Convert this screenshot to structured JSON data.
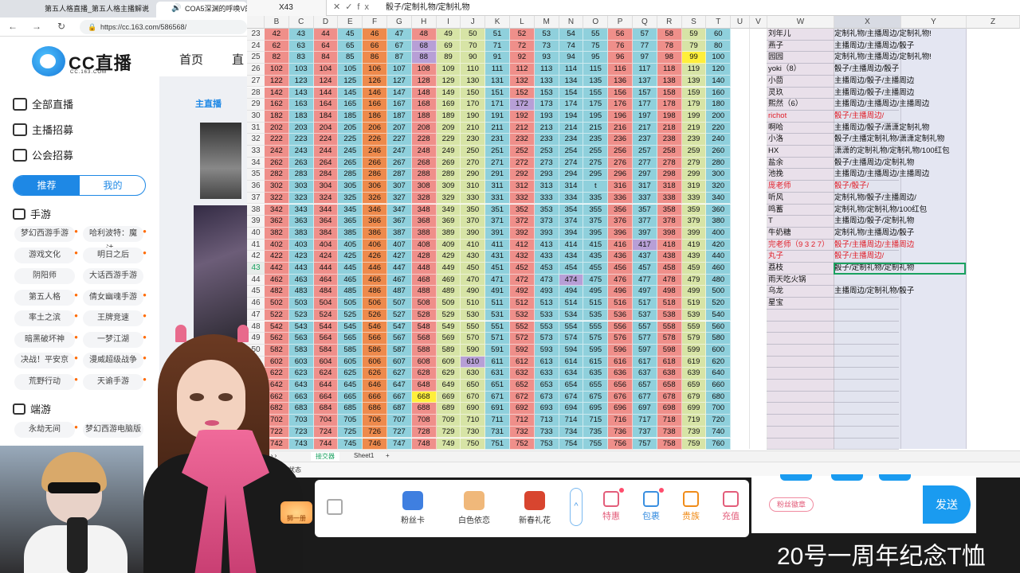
{
  "browser": {
    "tabs": [
      {
        "label": "第五人格直播_第五人格主播解说",
        "active": false
      },
      {
        "label": "COA5深渊的呼唤V的",
        "active": true
      }
    ],
    "url": "https://cc.163.com/586568/"
  },
  "site": {
    "logo_text": "CC直播",
    "logo_sub": "CC.163.COM",
    "top_nav": [
      "首页",
      "直"
    ],
    "sidebar": [
      {
        "label": "全部直播"
      },
      {
        "label": "主播招募"
      },
      {
        "label": "公会招募"
      }
    ],
    "segment": {
      "on": "推荐",
      "off": "我的"
    },
    "mobile_title": "手游",
    "mobile_games": [
      "梦幻西游手游",
      "哈利波特：魔法...",
      "游戏文化",
      "明日之后",
      "阴阳师",
      "大话西游手游",
      "第五人格",
      "倩女幽魂手游",
      "率土之滨",
      "王牌竞速",
      "暗黑破坏神",
      "一梦江湖",
      "决战！平安京",
      "漫威超级战争",
      "荒野行动",
      "天谕手游"
    ],
    "pc_title": "端游",
    "pc_games": [
      "永劫无间",
      "梦幻西游电脑版"
    ],
    "recommend_label": "主直播"
  },
  "sheet": {
    "cell_ref": "X43",
    "formula": "骰子/定制礼物/定制礼物",
    "columns": [
      "B",
      "C",
      "D",
      "E",
      "F",
      "G",
      "H",
      "I",
      "J",
      "K",
      "L",
      "M",
      "N",
      "O",
      "P",
      "Q",
      "R",
      "S",
      "T",
      "U",
      "V",
      "W",
      "X",
      "Y",
      "Z"
    ],
    "first_row": 23,
    "rows": [
      {
        "r": 23,
        "cells": [
          "42",
          "43",
          "44",
          "45",
          "46",
          "47",
          "48",
          "49",
          "50",
          "51",
          "52",
          "53",
          "54",
          "55",
          "56",
          "57",
          "58",
          "59",
          "60"
        ]
      },
      {
        "r": 24,
        "cells": [
          "62",
          "63",
          "64",
          "65",
          "66",
          "67",
          "68",
          "69",
          "70",
          "71",
          "72",
          "73",
          "74",
          "75",
          "76",
          "77",
          "78",
          "79",
          "80"
        ]
      },
      {
        "r": 25,
        "cells": [
          "82",
          "83",
          "84",
          "85",
          "86",
          "87",
          "88",
          "89",
          "90",
          "91",
          "92",
          "93",
          "94",
          "95",
          "96",
          "97",
          "98",
          "99",
          "100"
        ]
      },
      {
        "r": 26,
        "cells": [
          "102",
          "103",
          "104",
          "105",
          "106",
          "107",
          "108",
          "109",
          "110",
          "111",
          "112",
          "113",
          "114",
          "115",
          "116",
          "117",
          "118",
          "119",
          "120"
        ]
      },
      {
        "r": 27,
        "cells": [
          "122",
          "123",
          "124",
          "125",
          "126",
          "127",
          "128",
          "129",
          "130",
          "131",
          "132",
          "133",
          "134",
          "135",
          "136",
          "137",
          "138",
          "139",
          "140"
        ]
      },
      {
        "r": 28,
        "cells": [
          "142",
          "143",
          "144",
          "145",
          "146",
          "147",
          "148",
          "149",
          "150",
          "151",
          "152",
          "153",
          "154",
          "155",
          "156",
          "157",
          "158",
          "159",
          "160"
        ]
      },
      {
        "r": 29,
        "cells": [
          "162",
          "163",
          "164",
          "165",
          "166",
          "167",
          "168",
          "169",
          "170",
          "171",
          "172",
          "173",
          "174",
          "175",
          "176",
          "177",
          "178",
          "179",
          "180"
        ]
      },
      {
        "r": 30,
        "cells": [
          "182",
          "183",
          "184",
          "185",
          "186",
          "187",
          "188",
          "189",
          "190",
          "191",
          "192",
          "193",
          "194",
          "195",
          "196",
          "197",
          "198",
          "199",
          "200"
        ]
      },
      {
        "r": 31,
        "cells": [
          "202",
          "203",
          "204",
          "205",
          "206",
          "207",
          "208",
          "209",
          "210",
          "211",
          "212",
          "213",
          "214",
          "215",
          "216",
          "217",
          "218",
          "219",
          "220"
        ]
      },
      {
        "r": 32,
        "cells": [
          "222",
          "223",
          "224",
          "225",
          "226",
          "227",
          "228",
          "229",
          "230",
          "231",
          "232",
          "233",
          "234",
          "235",
          "236",
          "237",
          "238",
          "239",
          "240"
        ]
      },
      {
        "r": 33,
        "cells": [
          "242",
          "243",
          "244",
          "245",
          "246",
          "247",
          "248",
          "249",
          "250",
          "251",
          "252",
          "253",
          "254",
          "255",
          "256",
          "257",
          "258",
          "259",
          "260"
        ]
      },
      {
        "r": 34,
        "cells": [
          "262",
          "263",
          "264",
          "265",
          "266",
          "267",
          "268",
          "269",
          "270",
          "271",
          "272",
          "273",
          "274",
          "275",
          "276",
          "277",
          "278",
          "279",
          "280"
        ]
      },
      {
        "r": 35,
        "cells": [
          "282",
          "283",
          "284",
          "285",
          "286",
          "287",
          "288",
          "289",
          "290",
          "291",
          "292",
          "293",
          "294",
          "295",
          "296",
          "297",
          "298",
          "299",
          "300"
        ]
      },
      {
        "r": 36,
        "cells": [
          "302",
          "303",
          "304",
          "305",
          "306",
          "307",
          "308",
          "309",
          "310",
          "311",
          "312",
          "313",
          "314",
          "t",
          "316",
          "317",
          "318",
          "319",
          "320"
        ]
      },
      {
        "r": 37,
        "cells": [
          "322",
          "323",
          "324",
          "325",
          "326",
          "327",
          "328",
          "329",
          "330",
          "331",
          "332",
          "333",
          "334",
          "335",
          "336",
          "337",
          "338",
          "339",
          "340"
        ]
      },
      {
        "r": 38,
        "cells": [
          "342",
          "343",
          "344",
          "345",
          "346",
          "347",
          "348",
          "349",
          "350",
          "351",
          "352",
          "353",
          "354",
          "355",
          "356",
          "357",
          "358",
          "359",
          "360"
        ]
      },
      {
        "r": 39,
        "cells": [
          "362",
          "363",
          "364",
          "365",
          "366",
          "367",
          "368",
          "369",
          "370",
          "371",
          "372",
          "373",
          "374",
          "375",
          "376",
          "377",
          "378",
          "379",
          "380"
        ]
      },
      {
        "r": 40,
        "cells": [
          "382",
          "383",
          "384",
          "385",
          "386",
          "387",
          "388",
          "389",
          "390",
          "391",
          "392",
          "393",
          "394",
          "395",
          "396",
          "397",
          "398",
          "399",
          "400"
        ]
      },
      {
        "r": 41,
        "cells": [
          "402",
          "403",
          "404",
          "405",
          "406",
          "407",
          "408",
          "409",
          "410",
          "411",
          "412",
          "413",
          "414",
          "415",
          "416",
          "417",
          "418",
          "419",
          "420"
        ]
      },
      {
        "r": 42,
        "cells": [
          "422",
          "423",
          "424",
          "425",
          "426",
          "427",
          "428",
          "429",
          "430",
          "431",
          "432",
          "433",
          "434",
          "435",
          "436",
          "437",
          "438",
          "439",
          "440"
        ]
      },
      {
        "r": 43,
        "cells": [
          "442",
          "443",
          "444",
          "445",
          "446",
          "447",
          "448",
          "449",
          "450",
          "451",
          "452",
          "453",
          "454",
          "455",
          "456",
          "457",
          "458",
          "459",
          "460"
        ]
      },
      {
        "r": 44,
        "cells": [
          "462",
          "463",
          "464",
          "465",
          "466",
          "467",
          "468",
          "469",
          "470",
          "471",
          "472",
          "473",
          "474",
          "475",
          "476",
          "477",
          "478",
          "479",
          "480"
        ]
      },
      {
        "r": 45,
        "cells": [
          "482",
          "483",
          "484",
          "485",
          "486",
          "487",
          "488",
          "489",
          "490",
          "491",
          "492",
          "493",
          "494",
          "495",
          "496",
          "497",
          "498",
          "499",
          "500"
        ]
      },
      {
        "r": 46,
        "cells": [
          "502",
          "503",
          "504",
          "505",
          "506",
          "507",
          "508",
          "509",
          "510",
          "511",
          "512",
          "513",
          "514",
          "515",
          "516",
          "517",
          "518",
          "519",
          "520"
        ]
      },
      {
        "r": 47,
        "cells": [
          "522",
          "523",
          "524",
          "525",
          "526",
          "527",
          "528",
          "529",
          "530",
          "531",
          "532",
          "533",
          "534",
          "535",
          "536",
          "537",
          "538",
          "539",
          "540"
        ]
      },
      {
        "r": 48,
        "cells": [
          "542",
          "543",
          "544",
          "545",
          "546",
          "547",
          "548",
          "549",
          "550",
          "551",
          "552",
          "553",
          "554",
          "555",
          "556",
          "557",
          "558",
          "559",
          "560"
        ]
      },
      {
        "r": 49,
        "cells": [
          "562",
          "563",
          "564",
          "565",
          "566",
          "567",
          "568",
          "569",
          "570",
          "571",
          "572",
          "573",
          "574",
          "575",
          "576",
          "577",
          "578",
          "579",
          "580"
        ]
      },
      {
        "r": 50,
        "cells": [
          "582",
          "583",
          "584",
          "585",
          "586",
          "587",
          "588",
          "589",
          "590",
          "591",
          "592",
          "593",
          "594",
          "595",
          "596",
          "597",
          "598",
          "599",
          "600"
        ]
      },
      {
        "r": 51,
        "cells": [
          "602",
          "603",
          "604",
          "605",
          "606",
          "607",
          "608",
          "609",
          "610",
          "611",
          "612",
          "613",
          "614",
          "615",
          "616",
          "617",
          "618",
          "619",
          "620"
        ]
      },
      {
        "r": 52,
        "cells": [
          "622",
          "623",
          "624",
          "625",
          "626",
          "627",
          "628",
          "629",
          "630",
          "631",
          "632",
          "633",
          "634",
          "635",
          "636",
          "637",
          "638",
          "639",
          "640"
        ]
      },
      {
        "r": 53,
        "cells": [
          "642",
          "643",
          "644",
          "645",
          "646",
          "647",
          "648",
          "649",
          "650",
          "651",
          "652",
          "653",
          "654",
          "655",
          "656",
          "657",
          "658",
          "659",
          "660"
        ]
      },
      {
        "r": 54,
        "cells": [
          "662",
          "663",
          "664",
          "665",
          "666",
          "667",
          "668",
          "669",
          "670",
          "671",
          "672",
          "673",
          "674",
          "675",
          "676",
          "677",
          "678",
          "679",
          "680"
        ]
      },
      {
        "r": 55,
        "cells": [
          "682",
          "683",
          "684",
          "685",
          "686",
          "687",
          "688",
          "689",
          "690",
          "691",
          "692",
          "693",
          "694",
          "695",
          "696",
          "697",
          "698",
          "699",
          "700"
        ]
      },
      {
        "r": 56,
        "cells": [
          "702",
          "703",
          "704",
          "705",
          "706",
          "707",
          "708",
          "709",
          "710",
          "711",
          "712",
          "713",
          "714",
          "715",
          "716",
          "717",
          "718",
          "719",
          "720"
        ]
      },
      {
        "r": 57,
        "cells": [
          "722",
          "723",
          "724",
          "725",
          "726",
          "727",
          "728",
          "729",
          "730",
          "731",
          "732",
          "733",
          "734",
          "735",
          "736",
          "737",
          "738",
          "739",
          "740"
        ]
      },
      {
        "r": 58,
        "cells": [
          "742",
          "743",
          "744",
          "745",
          "746",
          "747",
          "748",
          "749",
          "750",
          "751",
          "752",
          "753",
          "754",
          "755",
          "756",
          "757",
          "758",
          "759",
          "760"
        ]
      }
    ],
    "column_colors": [
      "#ef8f8a",
      "#8fd0dc",
      "#ef8f8a",
      "#8fd0dc",
      "#ee8a4c",
      "#8fd0dc",
      "#ef8f8a",
      "#d7e4a6",
      "#d7e4a6",
      "#8fd0dc",
      "#ef8f8a",
      "#8fd0dc",
      "#8fd0dc",
      "#8fd0dc",
      "#ef8f8a",
      "#8fd0dc",
      "#ef8f8a",
      "#d7e4a6",
      "#8fd0dc"
    ],
    "highlights": [
      {
        "r": 24,
        "col": 6,
        "color": "#b79fd6"
      },
      {
        "r": 25,
        "col": 6,
        "color": "#b79fd6"
      },
      {
        "r": 25,
        "col": 17,
        "color": "#ffef3a"
      },
      {
        "r": 29,
        "col": 10,
        "color": "#b79fd6"
      },
      {
        "r": 41,
        "col": 15,
        "color": "#b79fd6"
      },
      {
        "r": 44,
        "col": 12,
        "color": "#b79fd6"
      },
      {
        "r": 51,
        "col": 8,
        "color": "#b79fd6"
      },
      {
        "r": 54,
        "col": 6,
        "color": "#ffef3a"
      }
    ],
    "selected_row": 43,
    "names": [
      {
        "r": 23,
        "name": "刘年儿",
        "gift": "定制礼物/主播周边/定制礼物!",
        "red": false
      },
      {
        "r": 24,
        "name": "燕子",
        "gift": "主播周边/主播周边/骰子",
        "red": false
      },
      {
        "r": 25,
        "name": "园园",
        "gift": "定制礼物/主播周边/定制礼物!",
        "red": false
      },
      {
        "r": 26,
        "name": "yoki（8）",
        "gift": "骰子/主播周边/骰子",
        "red": false
      },
      {
        "r": 27,
        "name": "小茴",
        "gift": "主播周边/骰子/主播周边",
        "red": false
      },
      {
        "r": 28,
        "name": "灵玖",
        "gift": "主播周边/骰子/主播周边",
        "red": false
      },
      {
        "r": 29,
        "name": "熙然（6）",
        "gift": "主播周边/主播周边/主播周边",
        "red": false
      },
      {
        "r": 30,
        "name": "richot",
        "gift": "骰子/主播周边/",
        "red": true
      },
      {
        "r": 31,
        "name": "啊哈",
        "gift": "主播周边/骰子/潇潇定制礼物",
        "red": false
      },
      {
        "r": 32,
        "name": "小洛",
        "gift": "骰子/主播定制礼物/潇潇定制礼物",
        "red": false
      },
      {
        "r": 33,
        "name": "HX",
        "gift": "潇潇的定制礼物/定制礼物/100红包",
        "red": false
      },
      {
        "r": 34,
        "name": "盐余",
        "gift": "骰子/主播周边/定制礼物",
        "red": false
      },
      {
        "r": 35,
        "name": "池挽",
        "gift": "主播周边/主播周边/主播周边",
        "red": false
      },
      {
        "r": 36,
        "name": "庞老师",
        "gift": "骰子/骰子/",
        "red": true
      },
      {
        "r": 37,
        "name": "听风",
        "gift": "定制礼物/骰子/主播周边/",
        "red": false
      },
      {
        "r": 38,
        "name": "鸣蓄",
        "gift": "定制礼物/定制礼物/100红包",
        "red": false
      },
      {
        "r": 39,
        "name": "T",
        "gift": "主播周边/骰子/定制礼物",
        "red": false
      },
      {
        "r": 40,
        "name": "牛奶糖",
        "gift": "定制礼物/主播周边/骰子",
        "red": false
      },
      {
        "r": 41,
        "name": "完老师（9 3 2 7）",
        "gift": "骰子/主播周边/主播周边",
        "red": true
      },
      {
        "r": 42,
        "name": "丸子",
        "gift": "骰子/主播周边/",
        "red": true
      },
      {
        "r": 43,
        "name": "荔枝",
        "gift": "骰子/定制礼物/定制礼物",
        "red": false
      },
      {
        "r": 44,
        "name": "雨天吃火锅",
        "gift": "",
        "red": false
      },
      {
        "r": 45,
        "name": "乌龙",
        "gift": "主播周边/定制礼物/骰子",
        "red": false
      },
      {
        "r": 46,
        "name": "星宝",
        "gift": "",
        "red": false
      }
    ],
    "sheet_tabs": [
      "接交器",
      "Sheet1",
      "+"
    ],
    "status": "编辑状态"
  },
  "gifts": [
    {
      "label": "粉丝卡",
      "color": "#3f7fe0"
    },
    {
      "label": "白色依恋",
      "color": "#f0b87a"
    },
    {
      "label": "新春礼花",
      "color": "#d8452f"
    }
  ],
  "shop": [
    {
      "label": "特惠",
      "color": "#e35d7a"
    },
    {
      "label": "包裹",
      "color": "#3a8fe0"
    },
    {
      "label": "贵族",
      "color": "#f08c1a"
    },
    {
      "label": "充值",
      "color": "#e35d7a"
    }
  ],
  "chat": {
    "fans_badge": "粉丝徽章",
    "send": "发送"
  },
  "fan_badge": "狮一册",
  "ticker": "20号一周年纪念T恤"
}
